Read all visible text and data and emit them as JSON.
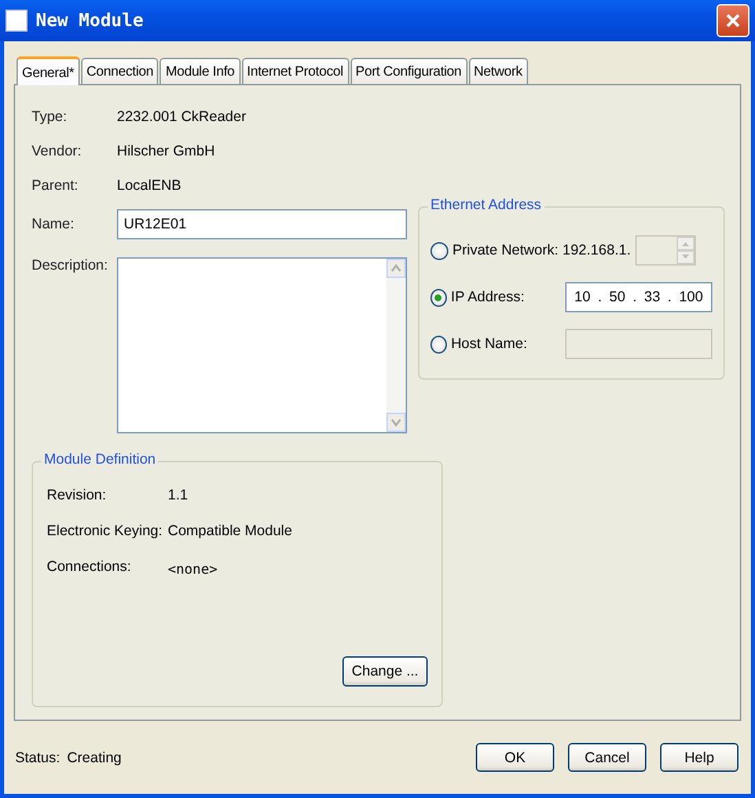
{
  "window": {
    "title": "New Module"
  },
  "tabs": [
    {
      "label": "General*",
      "selected": true
    },
    {
      "label": "Connection",
      "selected": false
    },
    {
      "label": "Module Info",
      "selected": false
    },
    {
      "label": "Internet Protocol",
      "selected": false
    },
    {
      "label": "Port Configuration",
      "selected": false
    },
    {
      "label": "Network",
      "selected": false
    }
  ],
  "info": [
    {
      "label": "Type:",
      "value": "2232.001 CkReader"
    },
    {
      "label": "Vendor:",
      "value": "Hilscher GmbH"
    },
    {
      "label": "Parent:",
      "value": "LocalENB"
    }
  ],
  "name_field": {
    "label": "Name:",
    "value": "UR12E01"
  },
  "description_field": {
    "label": "Description:"
  },
  "ethernet_address": {
    "title": "Ethernet Address",
    "options": [
      {
        "kind": "private",
        "label": "Private Network:",
        "prefix": "192.168.1.",
        "selected": false
      },
      {
        "kind": "ip",
        "label": "IP Address:",
        "octets": [
          "10",
          "50",
          "33",
          "100"
        ],
        "separator": ".",
        "selected": true
      },
      {
        "kind": "host",
        "label": "Host Name:",
        "selected": false
      }
    ]
  },
  "module_definition": {
    "title": "Module Definition",
    "rows": [
      {
        "label": "Revision:",
        "value": "1.1"
      },
      {
        "label": "Electronic Keying:",
        "value": "Compatible Module"
      },
      {
        "label": "Connections:",
        "value": "<none>"
      }
    ],
    "button": "Change ..."
  },
  "status": {
    "label": "Status:",
    "value": "Creating"
  },
  "buttons": [
    "OK",
    "Cancel",
    "Help"
  ]
}
